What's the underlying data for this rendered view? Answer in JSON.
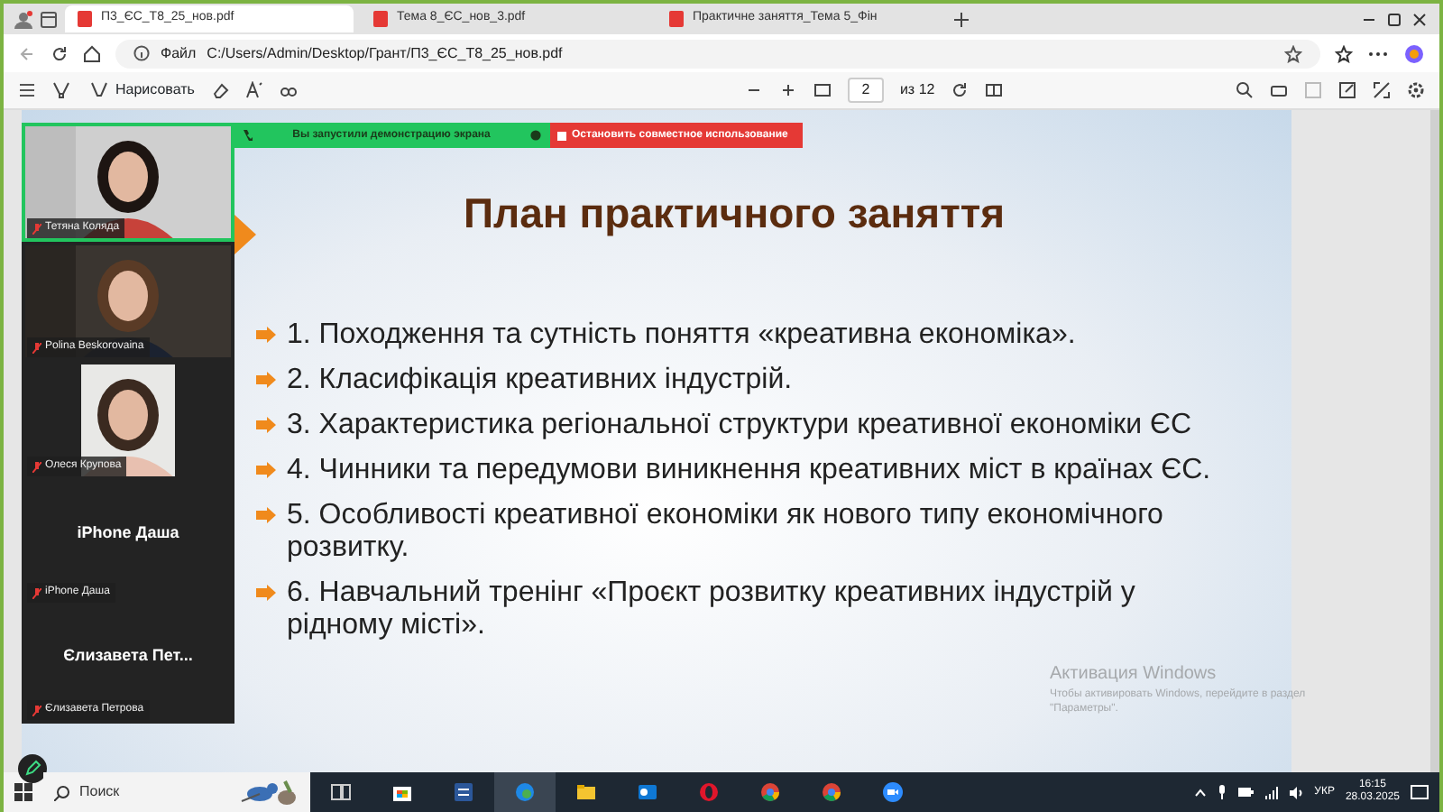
{
  "browser": {
    "tabs": [
      {
        "title": "П3_ЄС_Т8_25_нов.pdf",
        "selected": true
      },
      {
        "title": "Тема 8_ЄС_нов_3.pdf",
        "selected": false
      },
      {
        "title": "Практичне заняття_Тема 5_Фін",
        "selected": false
      }
    ],
    "address": {
      "scheme": "Файл",
      "url": "C:/Users/Admin/Desktop/Грант/П3_ЄС_Т8_25_нов.pdf"
    }
  },
  "pdf_toolbar": {
    "draw_label": "Нарисовать",
    "page": "2",
    "page_total": "из 12"
  },
  "share_bar": {
    "status": "Вы запустили демонстрацию экрана",
    "stop": "Остановить совместное использование"
  },
  "participants": [
    {
      "kind": "video",
      "name": "Тетяна Коляда",
      "active": true,
      "muted": true
    },
    {
      "kind": "video",
      "name": "Polina Beskorovaina",
      "active": false,
      "muted": true
    },
    {
      "kind": "video",
      "name": "Олеся Крупова",
      "active": false,
      "muted": true
    },
    {
      "kind": "avatar",
      "display": "iPhone Даша",
      "name": "iPhone Даша",
      "active": false,
      "muted": true
    },
    {
      "kind": "avatar",
      "display": "Єлизавета  Пет...",
      "name": "Єлизавета Петрова",
      "active": false,
      "muted": true
    }
  ],
  "slide": {
    "title": "План практичного заняття",
    "items": [
      "1. Походження та сутність поняття «креативна економіка».",
      "2. Класифікація креативних індустрій.",
      "3. Характеристика регіональної структури креативної економіки ЄС",
      "4. Чинники та передумови виникнення креативних міст в країнах ЄС.",
      "5. Особливості креативної економіки як нового типу економічного розвитку.",
      "6. Навчальний тренінг «Проєкт розвитку креативних індустрій у рідному місті»."
    ]
  },
  "activation": {
    "title": "Активация Windows",
    "text": "Чтобы активировать Windows, перейдите в раздел \"Параметры\"."
  },
  "taskbar": {
    "search": "Поиск",
    "language": "УКР",
    "time": "16:15",
    "date": "28.03.2025"
  }
}
